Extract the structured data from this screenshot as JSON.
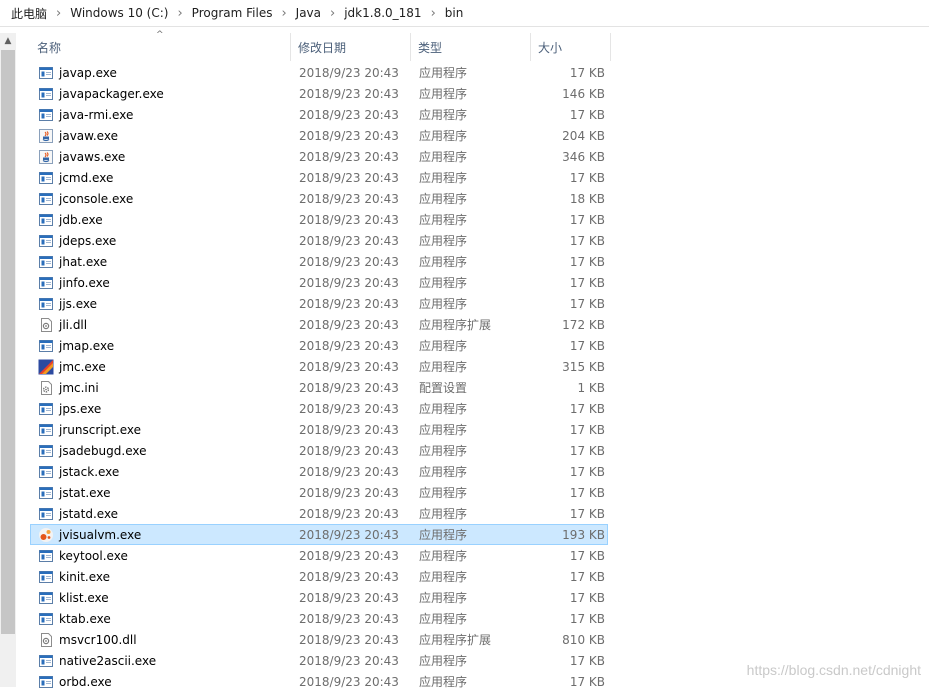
{
  "breadcrumb": [
    "此电脑",
    "Windows 10 (C:)",
    "Program Files",
    "Java",
    "jdk1.8.0_181",
    "bin"
  ],
  "columns": {
    "name": "名称",
    "date": "修改日期",
    "type": "类型",
    "size": "大小"
  },
  "files": [
    {
      "name": "javap.exe",
      "date": "2018/9/23 20:43",
      "type": "应用程序",
      "size": "17 KB",
      "icon": "exe-icon"
    },
    {
      "name": "javapackager.exe",
      "date": "2018/9/23 20:43",
      "type": "应用程序",
      "size": "146 KB",
      "icon": "exe-icon"
    },
    {
      "name": "java-rmi.exe",
      "date": "2018/9/23 20:43",
      "type": "应用程序",
      "size": "17 KB",
      "icon": "exe-icon"
    },
    {
      "name": "javaw.exe",
      "date": "2018/9/23 20:43",
      "type": "应用程序",
      "size": "204 KB",
      "icon": "java-cup-icon"
    },
    {
      "name": "javaws.exe",
      "date": "2018/9/23 20:43",
      "type": "应用程序",
      "size": "346 KB",
      "icon": "java-cup-icon"
    },
    {
      "name": "jcmd.exe",
      "date": "2018/9/23 20:43",
      "type": "应用程序",
      "size": "17 KB",
      "icon": "exe-icon"
    },
    {
      "name": "jconsole.exe",
      "date": "2018/9/23 20:43",
      "type": "应用程序",
      "size": "18 KB",
      "icon": "exe-icon"
    },
    {
      "name": "jdb.exe",
      "date": "2018/9/23 20:43",
      "type": "应用程序",
      "size": "17 KB",
      "icon": "exe-icon"
    },
    {
      "name": "jdeps.exe",
      "date": "2018/9/23 20:43",
      "type": "应用程序",
      "size": "17 KB",
      "icon": "exe-icon"
    },
    {
      "name": "jhat.exe",
      "date": "2018/9/23 20:43",
      "type": "应用程序",
      "size": "17 KB",
      "icon": "exe-icon"
    },
    {
      "name": "jinfo.exe",
      "date": "2018/9/23 20:43",
      "type": "应用程序",
      "size": "17 KB",
      "icon": "exe-icon"
    },
    {
      "name": "jjs.exe",
      "date": "2018/9/23 20:43",
      "type": "应用程序",
      "size": "17 KB",
      "icon": "exe-icon"
    },
    {
      "name": "jli.dll",
      "date": "2018/9/23 20:43",
      "type": "应用程序扩展",
      "size": "172 KB",
      "icon": "dll-icon"
    },
    {
      "name": "jmap.exe",
      "date": "2018/9/23 20:43",
      "type": "应用程序",
      "size": "17 KB",
      "icon": "exe-icon"
    },
    {
      "name": "jmc.exe",
      "date": "2018/9/23 20:43",
      "type": "应用程序",
      "size": "315 KB",
      "icon": "jmc-icon"
    },
    {
      "name": "jmc.ini",
      "date": "2018/9/23 20:43",
      "type": "配置设置",
      "size": "1 KB",
      "icon": "ini-icon"
    },
    {
      "name": "jps.exe",
      "date": "2018/9/23 20:43",
      "type": "应用程序",
      "size": "17 KB",
      "icon": "exe-icon"
    },
    {
      "name": "jrunscript.exe",
      "date": "2018/9/23 20:43",
      "type": "应用程序",
      "size": "17 KB",
      "icon": "exe-icon"
    },
    {
      "name": "jsadebugd.exe",
      "date": "2018/9/23 20:43",
      "type": "应用程序",
      "size": "17 KB",
      "icon": "exe-icon"
    },
    {
      "name": "jstack.exe",
      "date": "2018/9/23 20:43",
      "type": "应用程序",
      "size": "17 KB",
      "icon": "exe-icon"
    },
    {
      "name": "jstat.exe",
      "date": "2018/9/23 20:43",
      "type": "应用程序",
      "size": "17 KB",
      "icon": "exe-icon"
    },
    {
      "name": "jstatd.exe",
      "date": "2018/9/23 20:43",
      "type": "应用程序",
      "size": "17 KB",
      "icon": "exe-icon"
    },
    {
      "name": "jvisualvm.exe",
      "date": "2018/9/23 20:43",
      "type": "应用程序",
      "size": "193 KB",
      "icon": "jvisualvm-icon",
      "selected": true
    },
    {
      "name": "keytool.exe",
      "date": "2018/9/23 20:43",
      "type": "应用程序",
      "size": "17 KB",
      "icon": "exe-icon"
    },
    {
      "name": "kinit.exe",
      "date": "2018/9/23 20:43",
      "type": "应用程序",
      "size": "17 KB",
      "icon": "exe-icon"
    },
    {
      "name": "klist.exe",
      "date": "2018/9/23 20:43",
      "type": "应用程序",
      "size": "17 KB",
      "icon": "exe-icon"
    },
    {
      "name": "ktab.exe",
      "date": "2018/9/23 20:43",
      "type": "应用程序",
      "size": "17 KB",
      "icon": "exe-icon"
    },
    {
      "name": "msvcr100.dll",
      "date": "2018/9/23 20:43",
      "type": "应用程序扩展",
      "size": "810 KB",
      "icon": "dll-icon"
    },
    {
      "name": "native2ascii.exe",
      "date": "2018/9/23 20:43",
      "type": "应用程序",
      "size": "17 KB",
      "icon": "exe-icon"
    },
    {
      "name": "orbd.exe",
      "date": "2018/9/23 20:43",
      "type": "应用程序",
      "size": "17 KB",
      "icon": "exe-icon"
    }
  ],
  "watermark": "https://blog.csdn.net/cdnight",
  "colors": {
    "selection_bg": "#cce8ff",
    "selection_border": "#99d1ff",
    "header_text": "#4c607a",
    "exe_icon_blue": "#2a6ebb"
  }
}
